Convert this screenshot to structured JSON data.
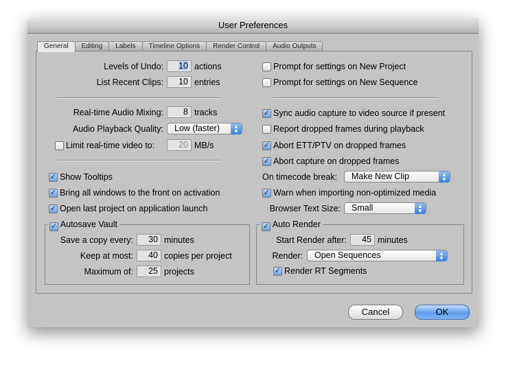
{
  "window": {
    "title": "User Preferences"
  },
  "tabs": [
    "General",
    "Editing",
    "Labels",
    "Timeline Options",
    "Render Control",
    "Audio Outputs"
  ],
  "left": {
    "levels_undo": {
      "label": "Levels of Undo:",
      "value": "10",
      "unit": "actions"
    },
    "recent_clips": {
      "label": "List Recent Clips:",
      "value": "10",
      "unit": "entries"
    },
    "audio_mixing": {
      "label": "Real-time Audio Mixing:",
      "value": "8",
      "unit": "tracks"
    },
    "playback_quality": {
      "label": "Audio Playback Quality:",
      "value": "Low (faster)"
    },
    "limit_video": {
      "label": "Limit real-time video to:",
      "value": "20",
      "unit": "MB/s",
      "checked": false
    },
    "show_tooltips": {
      "label": "Show Tooltips",
      "checked": true
    },
    "bring_windows": {
      "label": "Bring all windows to the front on activation",
      "checked": true
    },
    "open_last": {
      "label": "Open last project on application launch",
      "checked": true
    },
    "autosave": {
      "label": "Autosave Vault",
      "checked": true,
      "save_every": {
        "label": "Save a copy every:",
        "value": "30",
        "unit": "minutes"
      },
      "keep_most": {
        "label": "Keep at most:",
        "value": "40",
        "unit": "copies per project"
      },
      "maximum": {
        "label": "Maximum of:",
        "value": "25",
        "unit": "projects"
      }
    }
  },
  "right": {
    "prompt_project": {
      "label": "Prompt for settings on New Project",
      "checked": false
    },
    "prompt_sequence": {
      "label": "Prompt for settings on New Sequence",
      "checked": false
    },
    "sync_audio": {
      "label": "Sync audio capture to video source if present",
      "checked": true
    },
    "report_dropped": {
      "label": "Report dropped frames during playback",
      "checked": false
    },
    "abort_ett": {
      "label": "Abort ETT/PTV on dropped frames",
      "checked": true
    },
    "abort_capture": {
      "label": "Abort capture on dropped frames",
      "checked": true
    },
    "timecode_break": {
      "label": "On timecode break:",
      "value": "Make New Clip"
    },
    "warn_import": {
      "label": "Warn when importing non-optimized media",
      "checked": true
    },
    "browser_text": {
      "label": "Browser Text Size:",
      "value": "Small"
    },
    "auto_render": {
      "label": "Auto Render",
      "checked": true,
      "start_after": {
        "label": "Start Render after:",
        "value": "45",
        "unit": "minutes"
      },
      "render": {
        "label": "Render:",
        "value": "Open Sequences"
      },
      "rt_segments": {
        "label": "Render RT Segments",
        "checked": true
      }
    }
  },
  "buttons": {
    "cancel": "Cancel",
    "ok": "OK"
  }
}
